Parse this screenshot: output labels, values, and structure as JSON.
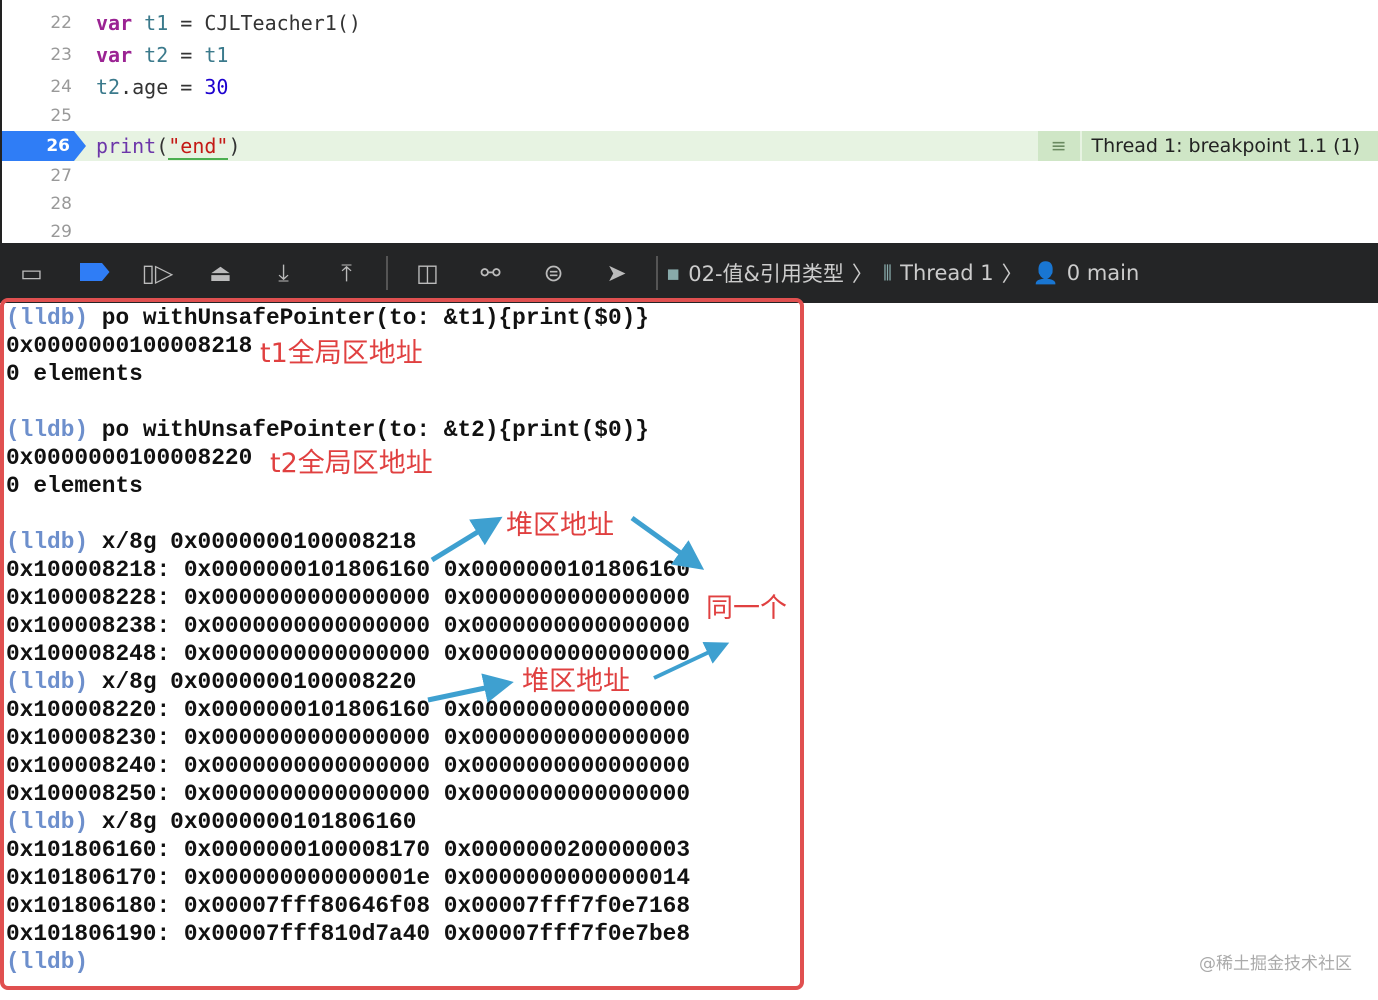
{
  "editor": {
    "lines": [
      {
        "n": "22",
        "tokens": [
          [
            "kw",
            "var"
          ],
          [
            "",
            " "
          ],
          [
            "id",
            "t1"
          ],
          [
            "",
            " = CJLTeacher1()"
          ]
        ]
      },
      {
        "n": "23",
        "tokens": [
          [
            "kw",
            "var"
          ],
          [
            "",
            " "
          ],
          [
            "id",
            "t2"
          ],
          [
            "",
            " = "
          ],
          [
            "id",
            "t1"
          ]
        ]
      },
      {
        "n": "24",
        "tokens": [
          [
            "id",
            "t2"
          ],
          [
            "",
            ".age = "
          ],
          [
            "num",
            "30"
          ]
        ]
      },
      {
        "n": "25",
        "tokens": []
      },
      {
        "n": "26",
        "tokens": [
          [
            "fn",
            "print"
          ],
          [
            "",
            "("
          ],
          [
            "str",
            "\"end\""
          ],
          [
            "",
            ")"
          ]
        ]
      },
      {
        "n": "27",
        "tokens": []
      },
      {
        "n": "28",
        "tokens": []
      },
      {
        "n": "29",
        "tokens": []
      }
    ],
    "current_line": "26",
    "breakpoint_label": "Thread 1: breakpoint 1.1 (1)"
  },
  "toolbar": {
    "icons": [
      "hide-debug-area-icon",
      "breakpoints-toggle-icon",
      "continue-icon",
      "step-over-icon",
      "step-into-icon",
      "step-out-icon",
      "view-hierarchy-icon",
      "memory-graph-icon",
      "environment-overrides-icon",
      "simulate-location-icon"
    ],
    "breadcrumbs": [
      "02-值&引用类型",
      "Thread 1",
      "0 main"
    ]
  },
  "console": {
    "prompt": "(lldb)",
    "lines": [
      {
        "p": true,
        "t": " po withUnsafePointer(to: &t1){print($0)}"
      },
      {
        "t": "0x0000000100008218"
      },
      {
        "t": "0 elements"
      },
      {
        "t": ""
      },
      {
        "p": true,
        "t": " po withUnsafePointer(to: &t2){print($0)}"
      },
      {
        "t": "0x0000000100008220"
      },
      {
        "t": "0 elements"
      },
      {
        "t": ""
      },
      {
        "p": true,
        "t": " x/8g 0x0000000100008218"
      },
      {
        "t": "0x100008218: 0x0000000101806160 0x0000000101806160"
      },
      {
        "t": "0x100008228: 0x0000000000000000 0x0000000000000000"
      },
      {
        "t": "0x100008238: 0x0000000000000000 0x0000000000000000"
      },
      {
        "t": "0x100008248: 0x0000000000000000 0x0000000000000000"
      },
      {
        "p": true,
        "t": " x/8g 0x0000000100008220"
      },
      {
        "t": "0x100008220: 0x0000000101806160 0x0000000000000000"
      },
      {
        "t": "0x100008230: 0x0000000000000000 0x0000000000000000"
      },
      {
        "t": "0x100008240: 0x0000000000000000 0x0000000000000000"
      },
      {
        "t": "0x100008250: 0x0000000000000000 0x0000000000000000"
      },
      {
        "p": true,
        "t": " x/8g 0x0000000101806160"
      },
      {
        "t": "0x101806160: 0x0000000100008170 0x0000000200000003"
      },
      {
        "t": "0x101806170: 0x000000000000001e 0x0000000000000014"
      },
      {
        "t": "0x101806180: 0x00007fff80646f08 0x00007fff7f0e7168"
      },
      {
        "t": "0x101806190: 0x00007fff810d7a40 0x00007fff7f0e7be8"
      },
      {
        "p": true,
        "t": ""
      }
    ]
  },
  "annotations": {
    "t1": "t1全局区地址",
    "t2": "t2全局区地址",
    "heap1": "堆区地址",
    "heap2": "堆区地址",
    "same": "同一个"
  },
  "watermark": "@稀土掘金技术社区",
  "colors": {
    "annotation": "#e04040",
    "arrow": "#3ea0d0",
    "prompt": "#6d8fcc",
    "current_line": "#2f7df6"
  }
}
